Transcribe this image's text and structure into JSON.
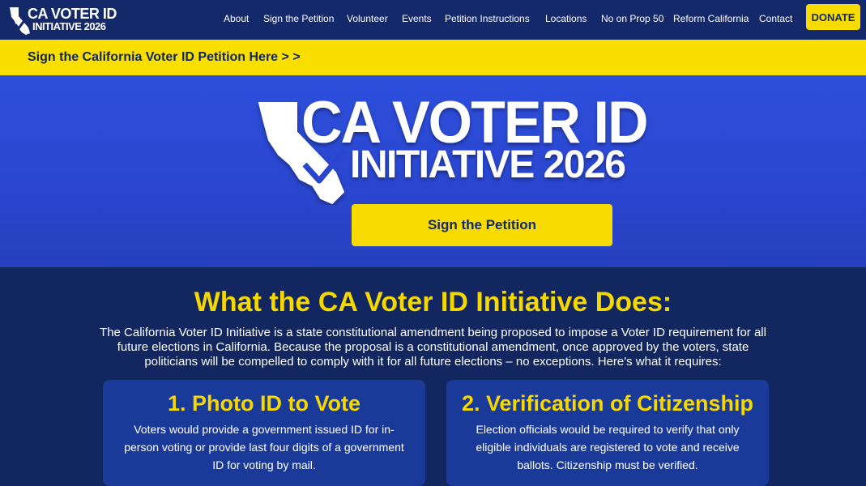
{
  "brand": {
    "line1": "CA VOTER ID",
    "line2": "INITIATIVE 2026"
  },
  "nav": {
    "items": [
      "About",
      "Sign the Petition",
      "Volunteer",
      "Events",
      "Petition Instructions",
      "Locations",
      "No on Prop 50",
      "Reform California",
      "Contact"
    ],
    "donate": "DONATE"
  },
  "banner": {
    "text": "Sign the California Voter ID Petition Here > >"
  },
  "hero": {
    "line1": "CA VOTER ID",
    "line2": "INITIATIVE 2026",
    "button": "Sign the Petition"
  },
  "main": {
    "heading": "What the CA Voter ID Initiative Does:",
    "intro": "The California Voter ID Initiative is a state constitutional amendment being proposed to impose a Voter ID requirement for all future elections in California. Because the proposal is a constitutional amendment, once approved by the voters, state politicians will be compelled to comply with it for all future elections – no exceptions. Here's what it requires:",
    "cards": [
      {
        "title": "1. Photo ID to Vote",
        "body": "Voters would provide a government issued ID for in-person voting or provide last four digits  of a government ID for voting by mail."
      },
      {
        "title": "2. Verification of Citizenship",
        "body": "Election officials would be required to verify that only eligible individuals are registered to vote and receive ballots. Citizenship must be verified."
      }
    ]
  },
  "colors": {
    "navy": "#14296a",
    "yellow": "#f8db00",
    "hero_blue": "#2d4fdc",
    "card": "#1a3a99"
  },
  "icons": {
    "logo": "california-checkmark-icon"
  }
}
